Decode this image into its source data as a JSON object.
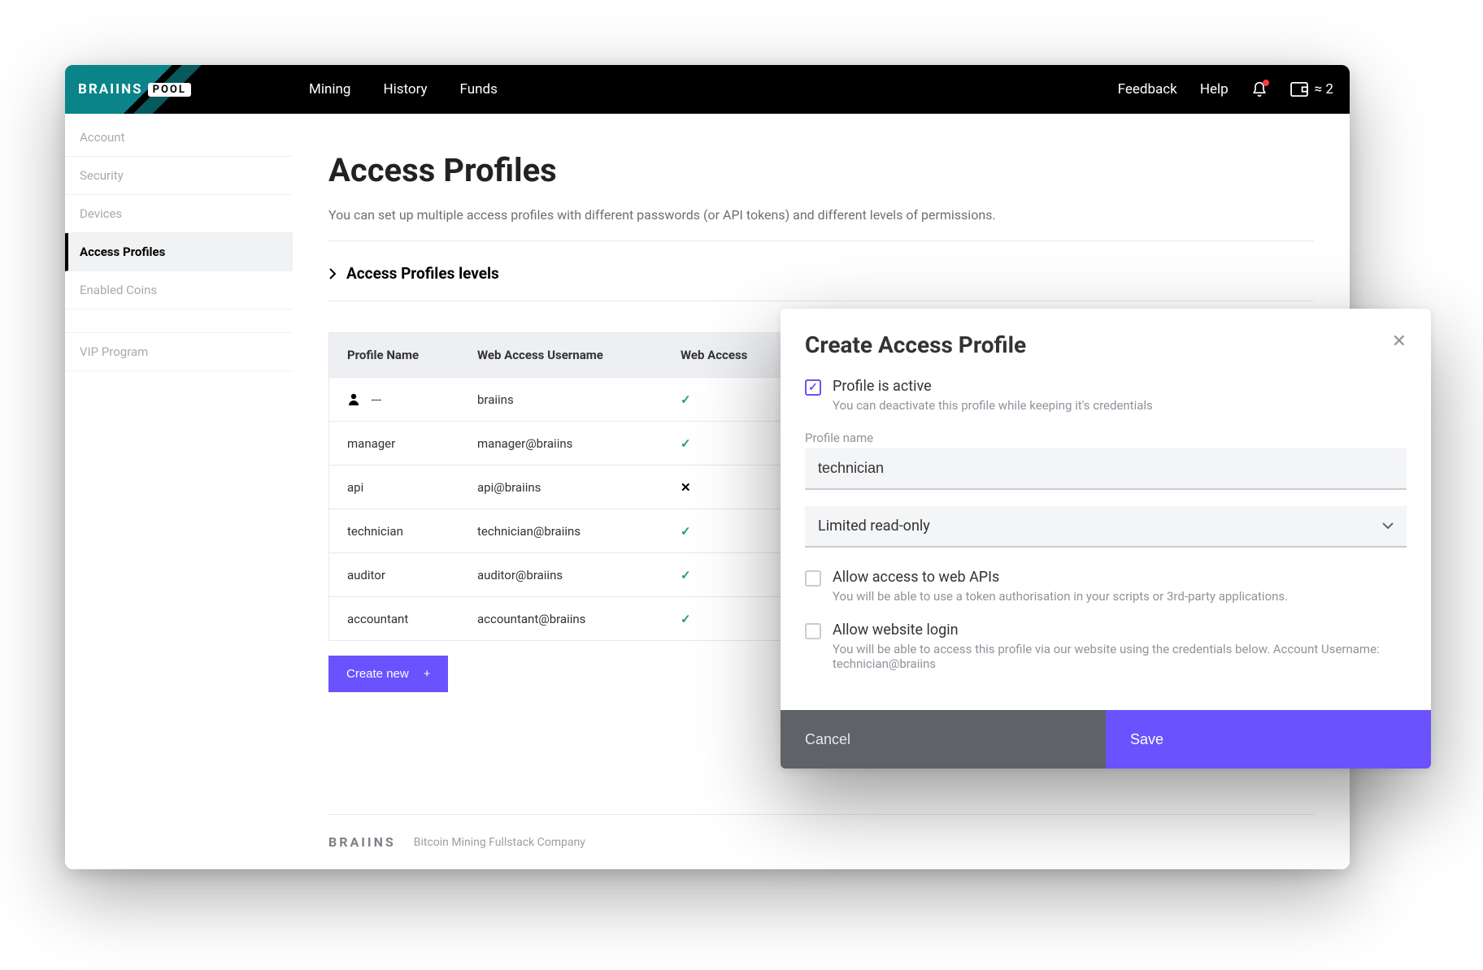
{
  "brand": {
    "name": "BRAIINS",
    "tag": "POOL"
  },
  "topnav": {
    "mining": "Mining",
    "history": "History",
    "funds": "Funds",
    "feedback": "Feedback",
    "help": "Help",
    "balance": "≈ 2"
  },
  "sidebar": {
    "items": [
      {
        "label": "Account"
      },
      {
        "label": "Security"
      },
      {
        "label": "Devices"
      },
      {
        "label": "Access Profiles"
      },
      {
        "label": "Enabled Coins"
      },
      {
        "label": "VIP Program"
      }
    ]
  },
  "page": {
    "title": "Access Profiles",
    "subtitle": "You can set up multiple access profiles with different passwords (or API tokens) and different levels of permissions.",
    "expander": "Access Profiles levels"
  },
  "table": {
    "headers": {
      "c1": "Profile Name",
      "c2": "Web Access Username",
      "c3": "Web Access"
    },
    "rows": [
      {
        "name": "---",
        "user": "braiins",
        "web": true,
        "owner": true
      },
      {
        "name": "manager",
        "user": "manager@braiins",
        "web": true
      },
      {
        "name": "api",
        "user": "api@braiins",
        "web": false
      },
      {
        "name": "technician",
        "user": "technician@braiins",
        "web": true
      },
      {
        "name": "auditor",
        "user": "auditor@braiins",
        "web": true
      },
      {
        "name": "accountant",
        "user": "accountant@braiins",
        "web": true
      }
    ]
  },
  "create_button": "Create new",
  "footer": {
    "logo": "BRAIINS",
    "tag": "Bitcoin Mining Fullstack Company"
  },
  "modal": {
    "title": "Create Access Profile",
    "active_label": "Profile is active",
    "active_help": "You can deactivate this profile while keeping it's credentials",
    "name_label": "Profile name",
    "name_value": "technician",
    "level_value": "Limited read-only",
    "api_label": "Allow access to web APIs",
    "api_help": "You will be able to use a token authorisation in your scripts or 3rd-party applications.",
    "web_label": "Allow website login",
    "web_help": "You will be able to access this profile via our website using the credentials below. Account Username: technician@braiins",
    "cancel": "Cancel",
    "save": "Save"
  }
}
